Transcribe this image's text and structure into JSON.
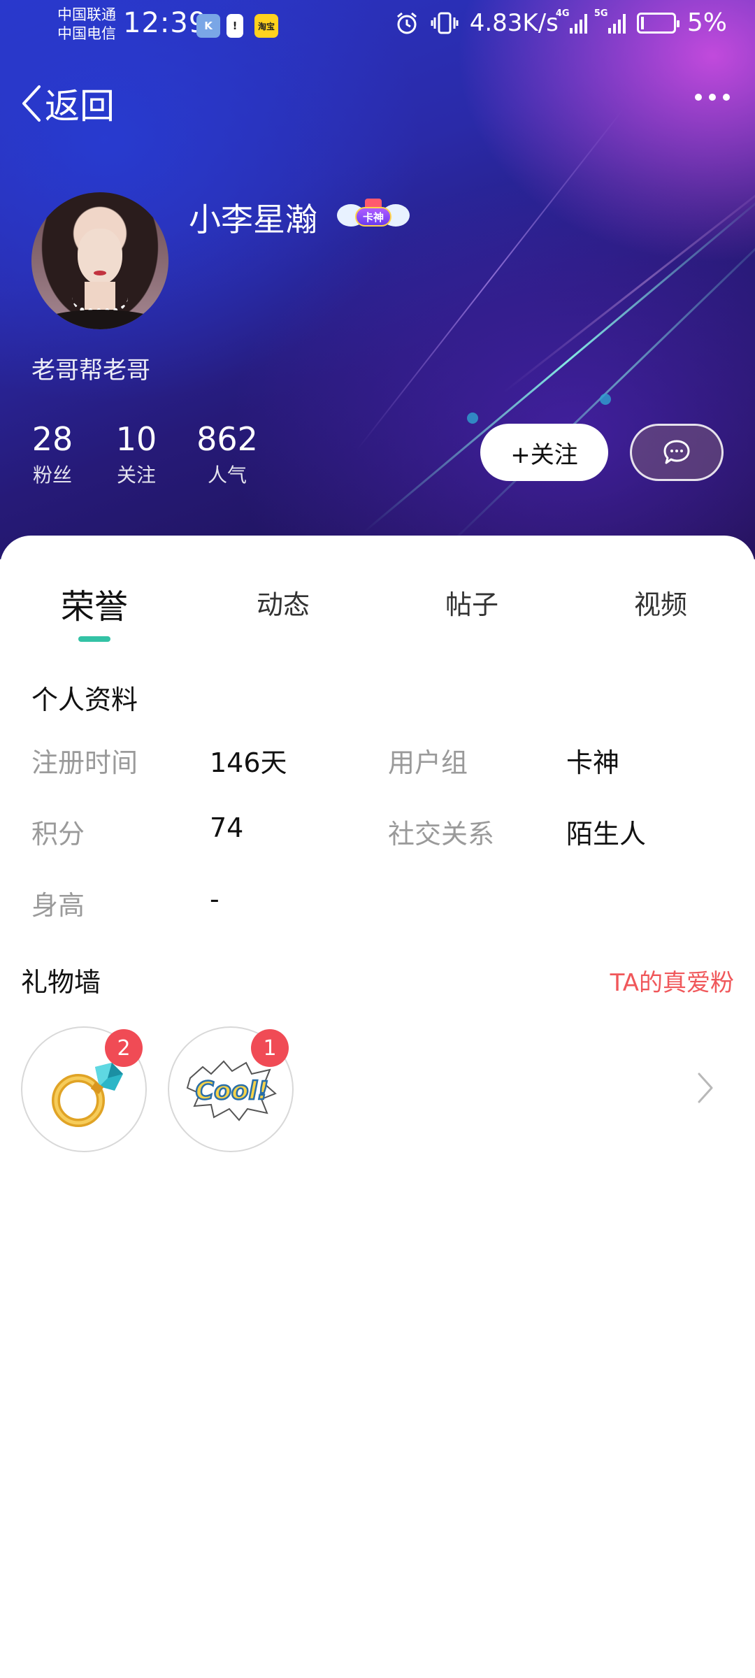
{
  "status_bar": {
    "carrier_1": "中国联通",
    "carrier_2": "中国电信",
    "time": "12:39",
    "app_icon_1": "K",
    "app_icon_2": "!",
    "app_icon_3": "淘宝",
    "network_speed": "4.83K/s",
    "signal_1_tag": "4G",
    "signal_2_tag": "5G",
    "battery": "5%",
    "icons": [
      "alarm-icon",
      "vibrate-icon",
      "signal-icon",
      "battery-icon"
    ]
  },
  "nav": {
    "back_label": "返回",
    "more_icon": "more-dots-icon"
  },
  "profile": {
    "username": "小李星瀚",
    "badge_label": "卡神",
    "signature": "老哥帮老哥",
    "stats": [
      {
        "value": "28",
        "label": "粉丝"
      },
      {
        "value": "10",
        "label": "关注"
      },
      {
        "value": "862",
        "label": "人气"
      }
    ],
    "follow_label": "+关注",
    "message_icon": "chat-bubble-icon"
  },
  "tabs": [
    {
      "label": "荣誉",
      "active": true
    },
    {
      "label": "动态",
      "active": false
    },
    {
      "label": "帖子",
      "active": false
    },
    {
      "label": "视频",
      "active": false
    }
  ],
  "personal_info": {
    "title": "个人资料",
    "rows": [
      {
        "label": "注册时间",
        "value": "146天"
      },
      {
        "label": "用户组",
        "value": "卡神"
      },
      {
        "label": "积分",
        "value": "74"
      },
      {
        "label": "社交关系",
        "value": "陌生人"
      },
      {
        "label": "身高",
        "value": "-"
      }
    ]
  },
  "gift_wall": {
    "title": "礼物墙",
    "link_label": "TA的真爱粉",
    "gifts": [
      {
        "icon": "diamond-ring-icon",
        "count": "2"
      },
      {
        "icon": "cool-sticker-icon",
        "count": "1",
        "text": "Cool!"
      }
    ]
  },
  "colors": {
    "accent": "#33c2a5",
    "link_red": "#f0575a",
    "badge_red": "#f04b55",
    "label_gray": "#9a9a9a"
  }
}
